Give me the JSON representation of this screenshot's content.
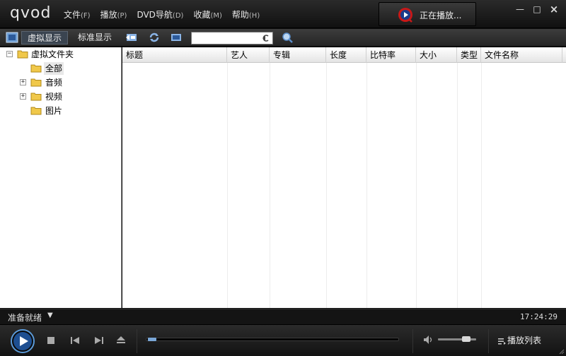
{
  "app": {
    "logo": "qvod"
  },
  "menu": [
    {
      "label": "文件",
      "accel": "(F)"
    },
    {
      "label": "播放",
      "accel": "(P)"
    },
    {
      "label": "DVD导航",
      "accel": "(D)"
    },
    {
      "label": "收藏",
      "accel": "(M)"
    },
    {
      "label": "帮助",
      "accel": "(H)"
    }
  ],
  "now_playing": {
    "label": "正在播放...",
    "icon": "play-circle-icon"
  },
  "toolbar": {
    "virtual_view": "虚拟显示",
    "standard_view": "标准显示",
    "search_value": "",
    "search_placeholder": ""
  },
  "tree": {
    "root": "虚拟文件夹",
    "items": [
      {
        "label": "全部",
        "expandable": false
      },
      {
        "label": "音频",
        "expandable": true
      },
      {
        "label": "视频",
        "expandable": true
      },
      {
        "label": "图片",
        "expandable": false
      }
    ]
  },
  "list": {
    "columns": [
      "标题",
      "艺人",
      "专辑",
      "长度",
      "比特率",
      "大小",
      "类型",
      "文件名称"
    ],
    "rows": []
  },
  "status": {
    "text": "准备就绪",
    "clock": "17:24:29"
  },
  "controls": {
    "playlist_label": "播放列表",
    "seek_progress": 0.0,
    "volume_level": 0.8
  },
  "colors": {
    "accent_blue": "#3b6db3",
    "brand_red": "#d42020",
    "selection": "#3a4450"
  }
}
